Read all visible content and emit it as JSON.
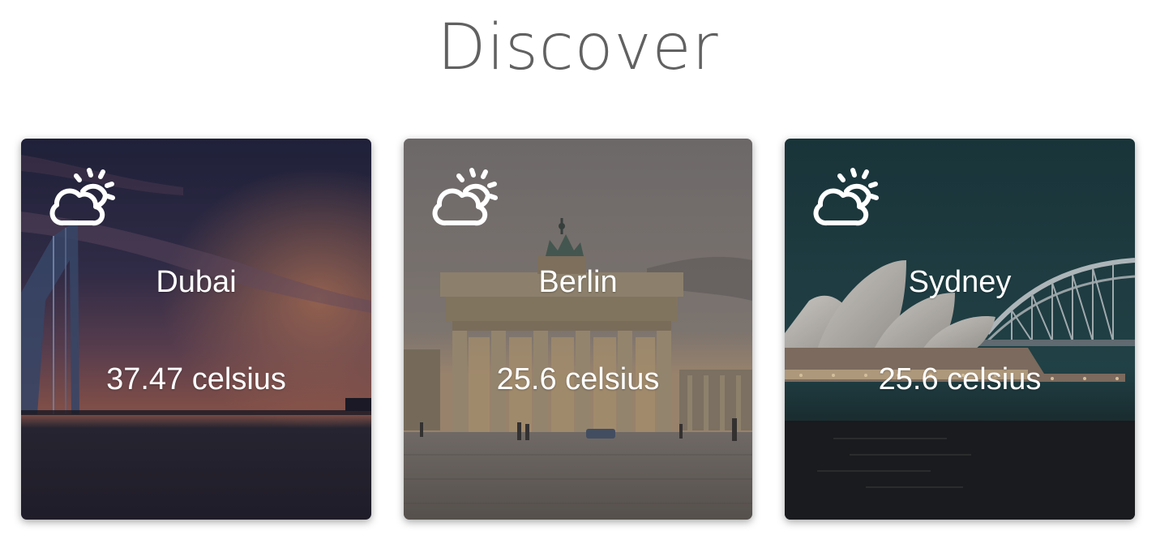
{
  "header": {
    "title": "Discover"
  },
  "cards": [
    {
      "city": "Dubai",
      "temperature": "37.47 celsius",
      "icon": "partly-cloudy-sun-icon",
      "colors": {
        "sky_top": "#2c2e4a",
        "sky_mid": "#5b4560",
        "sunset": "#c7785a",
        "water": "#26222c"
      }
    },
    {
      "city": "Berlin",
      "temperature": "25.6 celsius",
      "icon": "partly-cloudy-sun-icon",
      "colors": {
        "sky": "#7d7473",
        "stone": "#b5a187",
        "ground": "#6f6760"
      }
    },
    {
      "city": "Sydney",
      "temperature": "25.6 celsius",
      "icon": "partly-cloudy-sun-icon",
      "colors": {
        "sky": "#1d3d43",
        "sails": "#d9d5d0",
        "water": "#1d2023"
      }
    }
  ]
}
